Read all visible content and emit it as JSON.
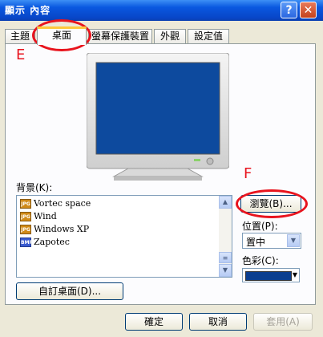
{
  "window": {
    "title": "顯示 內容",
    "help_glyph": "?",
    "close_glyph": "✕"
  },
  "tabs": [
    {
      "label": "主題"
    },
    {
      "label": "桌面"
    },
    {
      "label": "螢幕保護裝置"
    },
    {
      "label": "外觀"
    },
    {
      "label": "設定值"
    }
  ],
  "annotations": {
    "e": "E",
    "f": "F",
    "color": "#e8141e"
  },
  "background": {
    "label": "背景(K):",
    "items": [
      {
        "name": "Vortec space",
        "icon": "JPG"
      },
      {
        "name": "Wind",
        "icon": "JPG"
      },
      {
        "name": "Windows XP",
        "icon": "JPG"
      },
      {
        "name": "Zapotec",
        "icon": "BMP"
      }
    ]
  },
  "buttons": {
    "browse": "瀏覽(B)...",
    "customize": "自訂桌面(D)...",
    "ok": "確定",
    "cancel": "取消",
    "apply": "套用(A)"
  },
  "position": {
    "label": "位置(P):",
    "value": "置中"
  },
  "color": {
    "label": "色彩(C):",
    "value": "#0a3e8f"
  },
  "monitor": {
    "screen_color": "#0d4a9e"
  }
}
